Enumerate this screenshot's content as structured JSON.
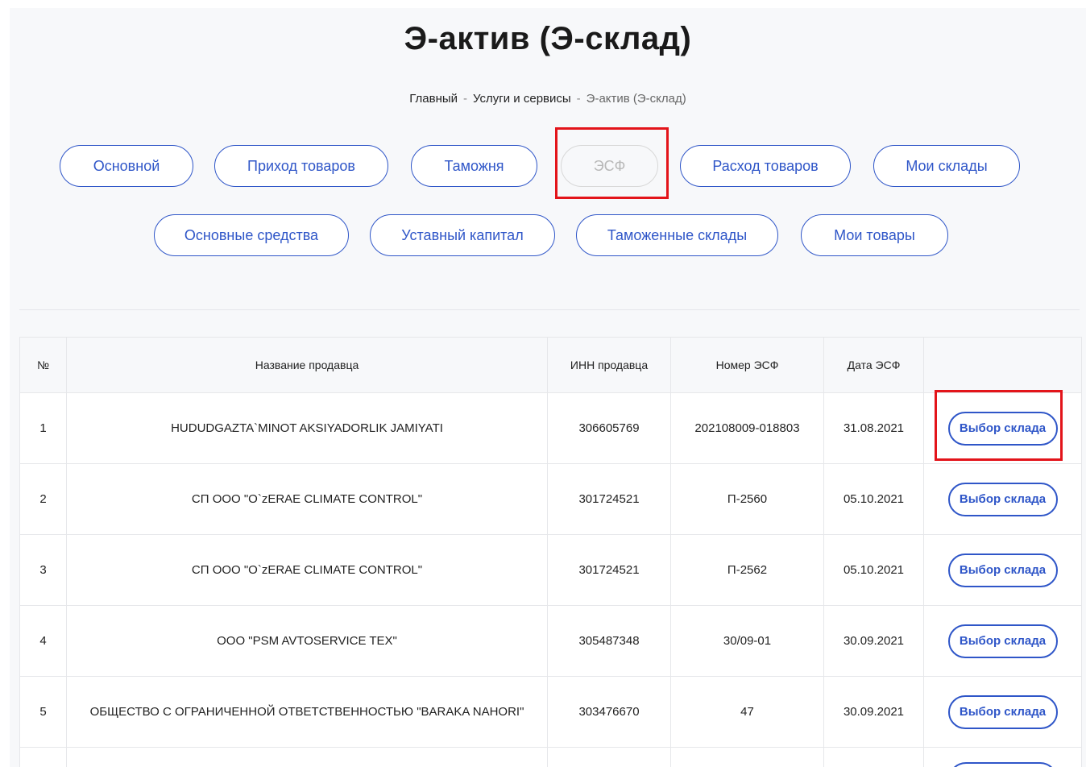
{
  "page": {
    "title": "Э-актив (Э-склад)"
  },
  "breadcrumb": {
    "items": [
      "Главный",
      "Услуги и сервисы"
    ],
    "separator": "-",
    "current": "Э-актив (Э-склад)"
  },
  "tabs": {
    "row1": [
      {
        "label": "Основной",
        "state": "enabled"
      },
      {
        "label": "Приход товаров",
        "state": "enabled"
      },
      {
        "label": "Таможня",
        "state": "enabled"
      },
      {
        "label": "ЭСФ",
        "state": "disabled"
      },
      {
        "label": "Расход товаров",
        "state": "enabled"
      },
      {
        "label": "Мои склады",
        "state": "enabled"
      }
    ],
    "row2": [
      {
        "label": "Основные средства",
        "state": "enabled"
      },
      {
        "label": "Уставный капитал",
        "state": "enabled"
      },
      {
        "label": "Таможенные склады",
        "state": "enabled"
      },
      {
        "label": "Мои товары",
        "state": "enabled"
      }
    ]
  },
  "table": {
    "headers": [
      "№",
      "Название продавца",
      "ИНН продавца",
      "Номер ЭСФ",
      "Дата ЭСФ",
      ""
    ],
    "action_label": "Выбор склада",
    "rows": [
      {
        "num": "1",
        "seller": "HUDUDGAZTA`MINOT AKSIYADORLIK JAMIYATI",
        "inn": "306605769",
        "esf_number": "202108009-018803",
        "esf_date": "31.08.2021"
      },
      {
        "num": "2",
        "seller": "СП ООО \"O`zERAE CLIMATE CONTROL\"",
        "inn": "301724521",
        "esf_number": "П-2560",
        "esf_date": "05.10.2021"
      },
      {
        "num": "3",
        "seller": "СП ООО \"O`zERAE CLIMATE CONTROL\"",
        "inn": "301724521",
        "esf_number": "П-2562",
        "esf_date": "05.10.2021"
      },
      {
        "num": "4",
        "seller": "ООО \"PSM AVTOSERVICE TEX\"",
        "inn": "305487348",
        "esf_number": "30/09-01",
        "esf_date": "30.09.2021"
      },
      {
        "num": "5",
        "seller": "ОБЩЕСТВО С ОГРАНИЧЕННОЙ ОТВЕТСТВЕННОСТЬЮ \"BARAKA NAHORI\"",
        "inn": "303476670",
        "esf_number": "47",
        "esf_date": "30.09.2021"
      }
    ]
  },
  "colors": {
    "accent": "#2f56c8",
    "highlight": "#e3141a",
    "disabled": "#b8b8b8"
  }
}
